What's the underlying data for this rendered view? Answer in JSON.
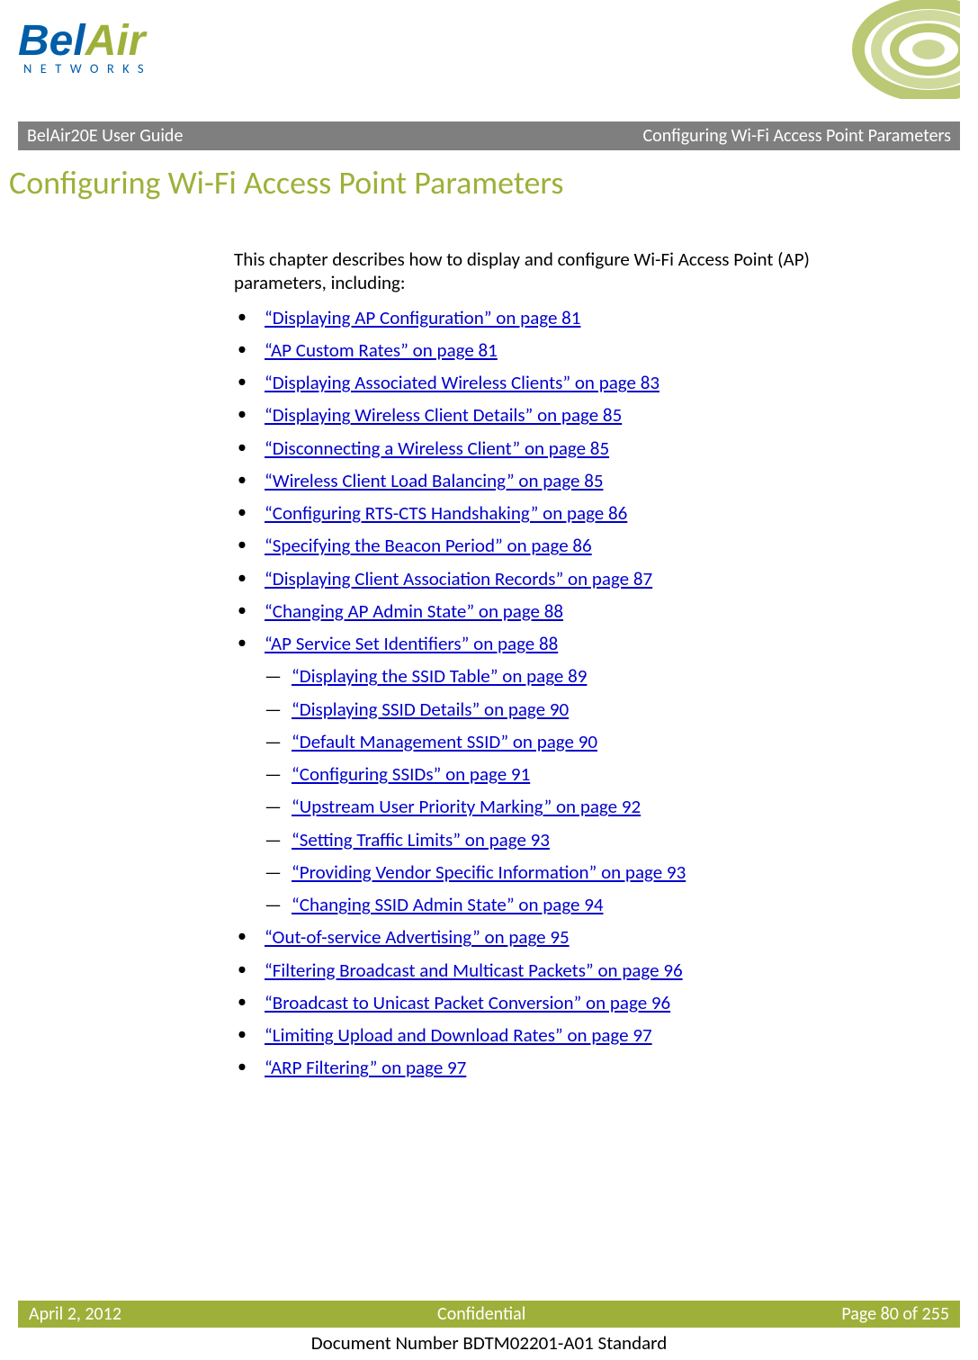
{
  "brand": {
    "part1": "Bel",
    "part2": "Air",
    "subtitle": "NETWORKS"
  },
  "headerBar": {
    "left": "BelAir20E User Guide",
    "right": "Configuring Wi-Fi Access Point Parameters"
  },
  "chapterTitle": "Configuring Wi-Fi Access Point Parameters",
  "intro": "This chapter describes how to display and configure Wi-Fi Access Point (AP) parameters, including:",
  "toc": [
    {
      "label": "“Displaying AP Configuration” on page 81"
    },
    {
      "label": "“AP Custom Rates” on page 81"
    },
    {
      "label": "“Displaying Associated Wireless Clients” on page 83"
    },
    {
      "label": "“Displaying Wireless Client Details” on page 85"
    },
    {
      "label": "“Disconnecting a Wireless Client” on page 85"
    },
    {
      "label": "“Wireless Client Load Balancing” on page 85"
    },
    {
      "label": "“Configuring RTS-CTS Handshaking” on page 86"
    },
    {
      "label": "“Specifying the Beacon Period” on page 86"
    },
    {
      "label": "“Displaying Client Association Records” on page 87"
    },
    {
      "label": "“Changing AP Admin State” on page 88"
    },
    {
      "label": "“AP Service Set Identifiers” on page 88",
      "sub": [
        {
          "label": "“Displaying the SSID Table” on page 89"
        },
        {
          "label": "“Displaying SSID Details” on page 90"
        },
        {
          "label": "“Default Management SSID” on page 90"
        },
        {
          "label": "“Configuring SSIDs” on page 91"
        },
        {
          "label": "“Upstream User Priority Marking” on page 92"
        },
        {
          "label": "“Setting Traffic Limits” on page 93"
        },
        {
          "label": "“Providing Vendor Specific Information” on page 93"
        },
        {
          "label": "“Changing SSID Admin State” on page 94"
        }
      ]
    },
    {
      "label": "“Out-of-service Advertising” on page 95"
    },
    {
      "label": "“Filtering Broadcast and Multicast Packets” on page 96"
    },
    {
      "label": "“Broadcast to Unicast Packet Conversion” on page 96"
    },
    {
      "label": "“Limiting Upload and Download Rates” on page 97"
    },
    {
      "label": "“ARP Filtering” on page 97"
    }
  ],
  "footer": {
    "date": "April 2, 2012",
    "center": "Confidential",
    "page": "Page 80 of 255",
    "docnum": "Document Number BDTM02201-A01 Standard"
  }
}
